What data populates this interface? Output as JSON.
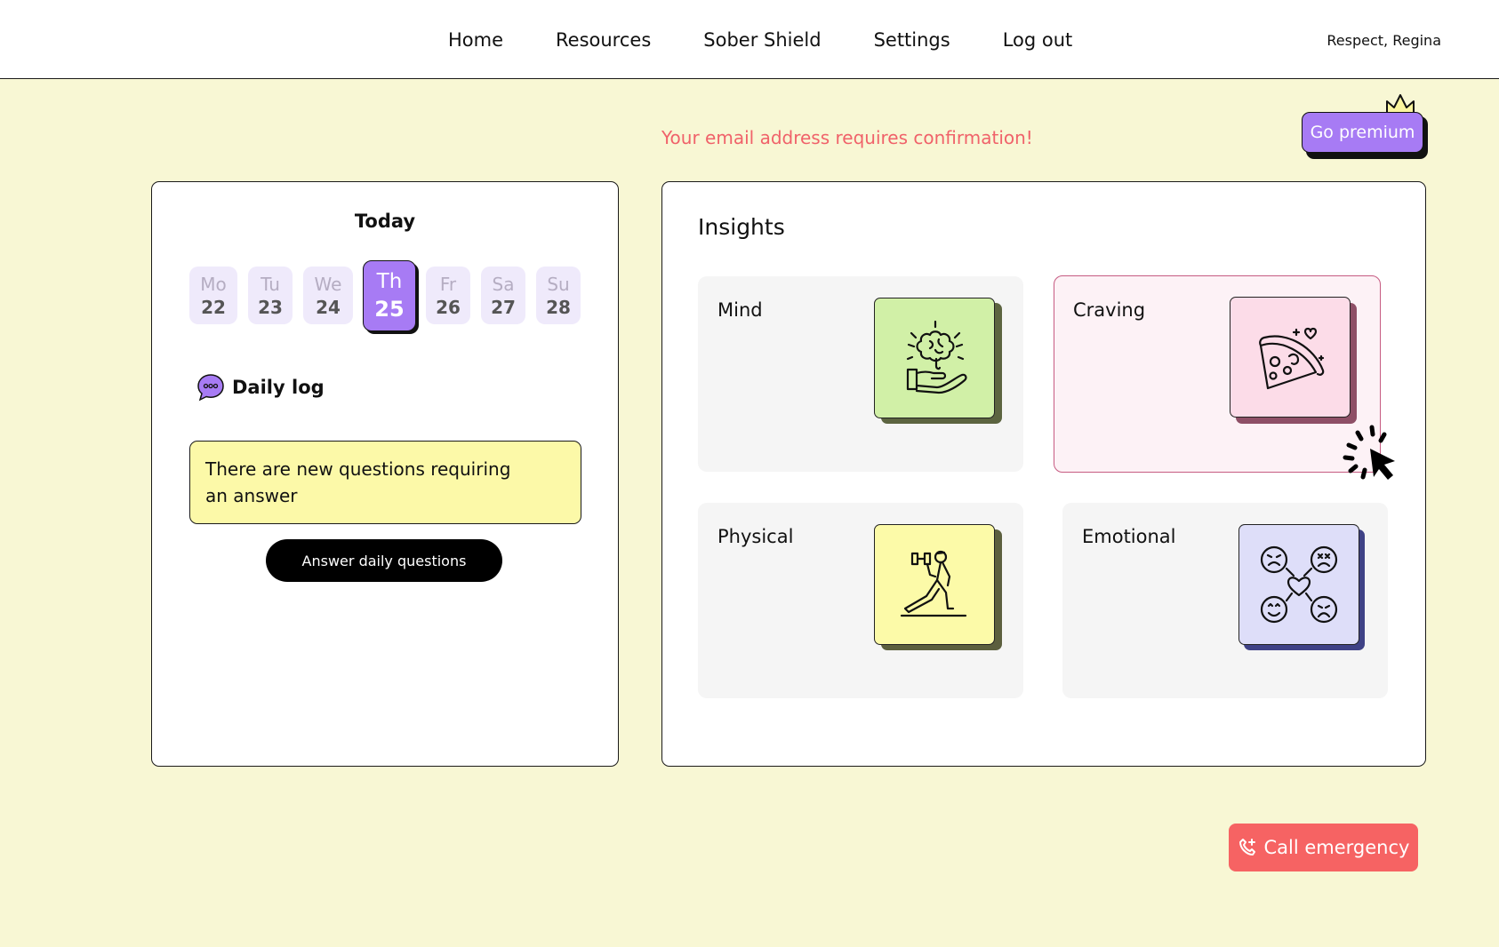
{
  "header": {
    "nav": [
      "Home",
      "Resources",
      "Sober Shield",
      "Settings",
      "Log out"
    ],
    "greeting": "Respect, Regina"
  },
  "banner": {
    "email_warning": "Your email address requires confirmation!",
    "premium_label": "Go premium"
  },
  "today": {
    "title": "Today",
    "days": [
      {
        "name": "Mo",
        "date": "22"
      },
      {
        "name": "Tu",
        "date": "23"
      },
      {
        "name": "We",
        "date": "24"
      },
      {
        "name": "Th",
        "date": "25"
      },
      {
        "name": "Fr",
        "date": "26"
      },
      {
        "name": "Sa",
        "date": "27"
      },
      {
        "name": "Su",
        "date": "28"
      }
    ],
    "active_day": "Th",
    "daily_log_label": "Daily log",
    "notice_text": "There are new questions requiring an answer",
    "answer_button": "Answer daily questions"
  },
  "insights": {
    "title": "Insights",
    "tiles": [
      {
        "label": "Mind",
        "icon": "brain-in-hand-icon",
        "color": "#D1F0A7",
        "shadow": "#5C6440"
      },
      {
        "label": "Craving",
        "icon": "pizza-slice-icon",
        "color": "#FCDCE8",
        "shadow": "#8E4F66"
      },
      {
        "label": "Physical",
        "icon": "exercise-dumbbell-icon",
        "color": "#FCFAA8",
        "shadow": "#5C5F3E"
      },
      {
        "label": "Emotional",
        "icon": "emotions-faces-icon",
        "color": "#DEDEF9",
        "shadow": "#3F4286"
      }
    ]
  },
  "emergency": {
    "label": "Call emergency",
    "color": "#F66363"
  },
  "colors": {
    "background": "#F8F7D4",
    "accent": "#A77BF4",
    "warning_text": "#F0626A"
  }
}
